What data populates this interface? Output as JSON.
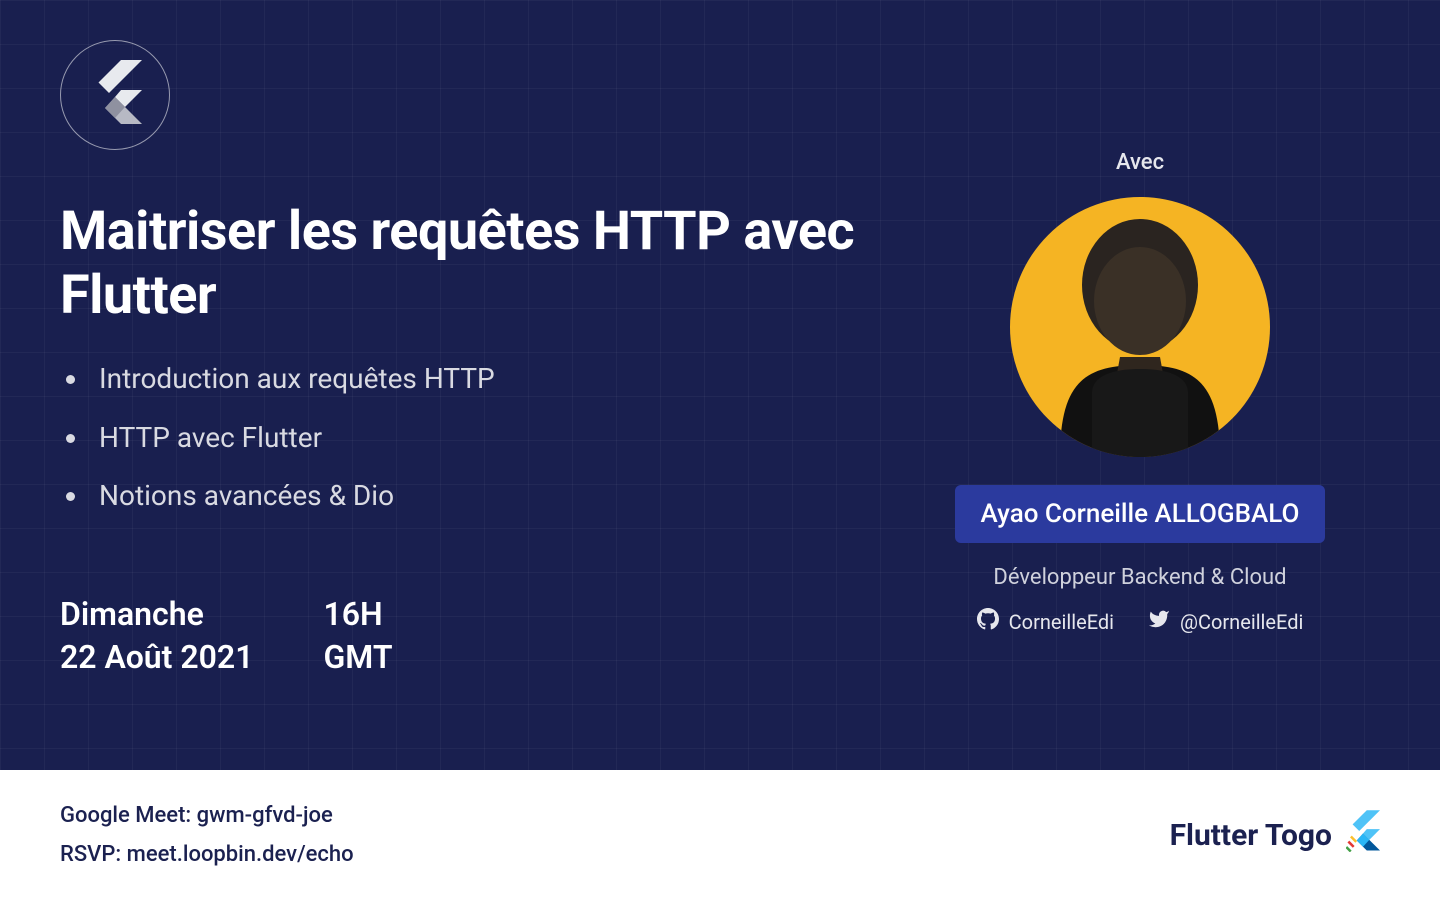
{
  "hero": {
    "title": "Maitriser les requêtes HTTP avec Flutter",
    "bullets": [
      "Introduction aux requêtes HTTP",
      "HTTP avec Flutter",
      "Notions avancées & Dio"
    ],
    "date_day": "Dimanche",
    "date_full": "22 Août 2021",
    "time": "16H",
    "tz": "GMT"
  },
  "speaker": {
    "avec_label": "Avec",
    "name": "Ayao Corneille ALLOGBALO",
    "role": "Développeur Backend & Cloud",
    "github": "CorneilleEdi",
    "twitter": "@CorneilleEdi"
  },
  "footer": {
    "meet_label": "Google Meet: gwm-gfvd-joe",
    "rsvp_label": "RSVP: meet.loopbin.dev/echo",
    "brand": "Flutter Togo"
  },
  "colors": {
    "bg": "#191F4F",
    "badge": "#2B3A9E",
    "avatar_bg": "#F5B423"
  }
}
